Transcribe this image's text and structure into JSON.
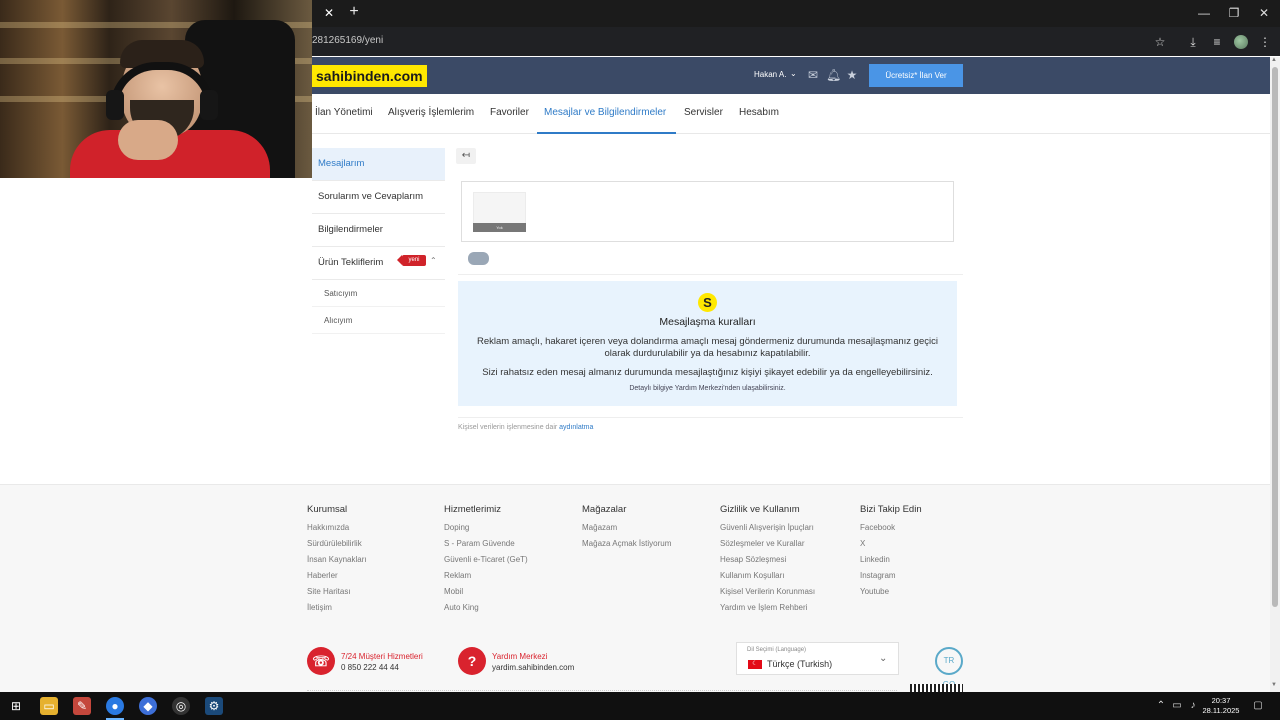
{
  "browser": {
    "url": "281265169/yeni"
  },
  "header": {
    "logo": "sahibinden.com",
    "user_name": "Hakan A.",
    "post_button": "Ücretsiz* İlan Ver"
  },
  "nav": {
    "items": [
      {
        "label": "İlan Yönetimi",
        "active": false
      },
      {
        "label": "Alışveriş İşlemlerim",
        "active": false
      },
      {
        "label": "Favoriler",
        "active": false
      },
      {
        "label": "Mesajlar ve Bilgilendirmeler",
        "active": true
      },
      {
        "label": "Servisler",
        "active": false
      },
      {
        "label": "Hesabım",
        "active": false
      }
    ]
  },
  "sidebar": {
    "items": [
      {
        "label": "Mesajlarım",
        "active": true
      },
      {
        "label": "Sorularım ve Cevaplarım",
        "active": false
      },
      {
        "label": "Bilgilendirmeler",
        "active": false
      },
      {
        "label": "Ürün Tekliflerim",
        "active": false
      }
    ],
    "badge": "yeni",
    "subitems": [
      "Satıcıyım",
      "Alıcıyım"
    ]
  },
  "main": {
    "back_icon": "back-arrow-icon",
    "thumb_label": "Yok",
    "rules": {
      "icon_letter": "S",
      "title": "Mesajlaşma kuralları",
      "p1": "Reklam amaçlı, hakaret içeren veya dolandırma amaçlı mesaj göndermeniz durumunda mesajlaşmanız geçici olarak durdurulabilir ya da hesabınız kapatılabilir.",
      "p2": "Sizi rahatsız eden mesaj almanız durumunda mesajlaştığınız kişiyi şikayet edebilir ya da engelleyebilirsiniz.",
      "p3": "Detaylı bilgiye Yardım Merkezi'nden ulaşabilirsiniz."
    },
    "privacy_text": "Kişisel verilerin işlenmesine dair",
    "privacy_link": "aydınlatma"
  },
  "footer": {
    "columns": [
      {
        "title": "Kurumsal",
        "links": [
          "Hakkımızda",
          "Sürdürülebilirlik",
          "İnsan Kaynakları",
          "Haberler",
          "Site Haritası",
          "İletişim"
        ]
      },
      {
        "title": "Hizmetlerimiz",
        "links": [
          "Doping",
          "S - Param Güvende",
          "Güvenli e-Ticaret (GeT)",
          "Reklam",
          "Mobil",
          "Auto King"
        ]
      },
      {
        "title": "Mağazalar",
        "links": [
          "Mağazam",
          "Mağaza Açmak İstiyorum"
        ]
      },
      {
        "title": "Gizlilik ve Kullanım",
        "links": [
          "Güvenli Alışverişin İpuçları",
          "Sözleşmeler ve Kurallar",
          "Hesap Sözleşmesi",
          "Kullanım Koşulları",
          "Kişisel Verilerin Korunması",
          "Yardım ve İşlem Rehberi"
        ]
      },
      {
        "title": "Bizi Takip Edin",
        "links": [
          "Facebook",
          "X",
          "Linkedin",
          "Instagram",
          "Youtube"
        ]
      }
    ],
    "support": {
      "title": "7/24 Müşteri Hizmetleri",
      "phone": "0 850 222 44 44"
    },
    "help": {
      "title": "Yardım Merkezi",
      "url": "yardim.sahibinden.com"
    },
    "language": {
      "label": "Dil Seçimi (Language)",
      "value": "Türkçe (Turkish)"
    },
    "trust_badge": "TR GO"
  },
  "taskbar": {
    "time": "20:37",
    "date": "28.11.2025"
  }
}
